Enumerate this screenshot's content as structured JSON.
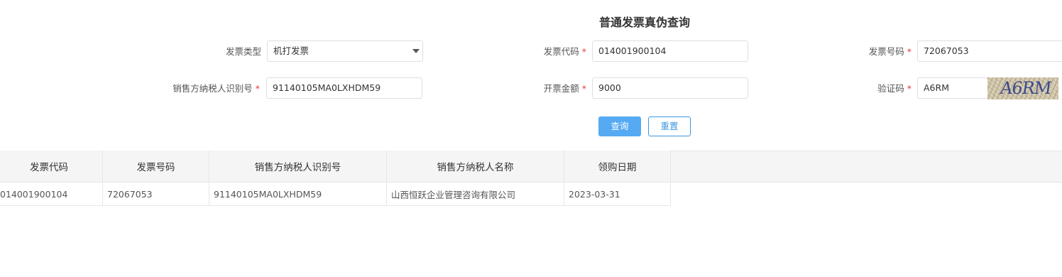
{
  "page": {
    "title": "普通发票真伪查询"
  },
  "form": {
    "invoice_type": {
      "label": "发票类型",
      "value": "机打发票"
    },
    "invoice_code": {
      "label": "发票代码",
      "value": "014001900104"
    },
    "invoice_number": {
      "label": "发票号码",
      "value": "72067053"
    },
    "seller_tax_id": {
      "label": "销售方纳税人识别号",
      "value": "91140105MA0LXHDM59"
    },
    "amount": {
      "label": "开票金额",
      "value": "9000"
    },
    "verify_code": {
      "label": "验证码",
      "value": "A6RM",
      "captcha_text": "A6RM"
    },
    "required_mark": "*"
  },
  "buttons": {
    "query": "查询",
    "reset": "重置"
  },
  "table": {
    "columns": [
      "发票代码",
      "发票号码",
      "销售方纳税人识别号",
      "销售方纳税人名称",
      "领购日期"
    ],
    "rows": [
      [
        "014001900104",
        "72067053",
        "91140105MA0LXHDM59",
        "山西恒跃企业管理咨询有限公司",
        "2023-03-31"
      ]
    ]
  }
}
